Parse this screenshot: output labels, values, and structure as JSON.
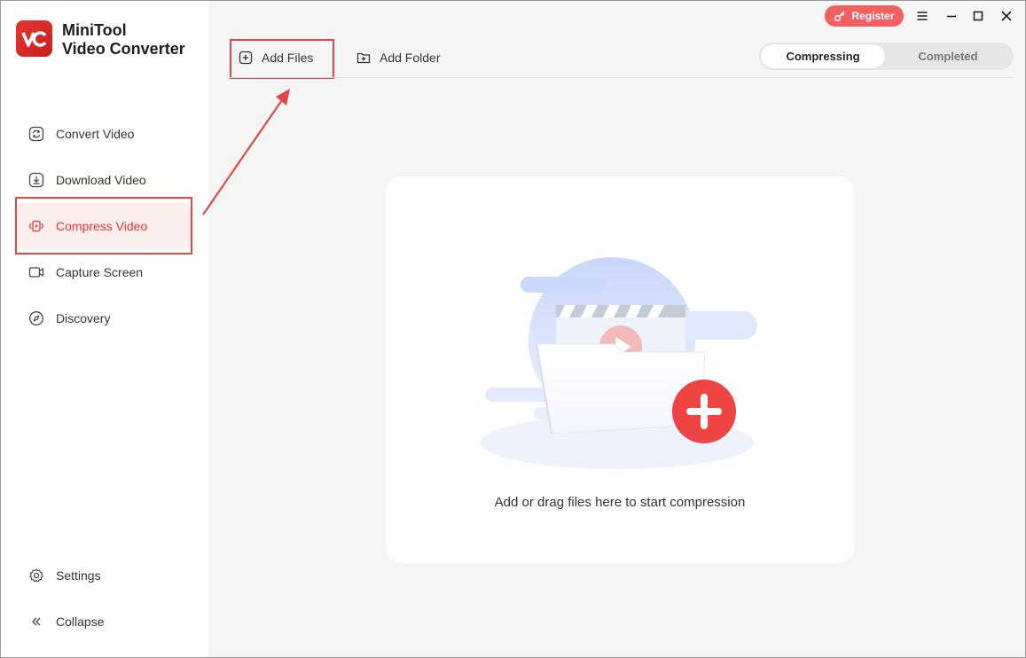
{
  "app": {
    "title_line1": "MiniTool",
    "title_line2": "Video Converter",
    "accent": "#e5362f"
  },
  "sidebar": {
    "items": [
      {
        "label": "Convert Video",
        "icon": "convert-icon",
        "active": false
      },
      {
        "label": "Download Video",
        "icon": "download-icon",
        "active": false
      },
      {
        "label": "Compress Video",
        "icon": "compress-icon",
        "active": true
      },
      {
        "label": "Capture Screen",
        "icon": "camera-icon",
        "active": false
      },
      {
        "label": "Discovery",
        "icon": "compass-icon",
        "active": false
      }
    ],
    "bottom": [
      {
        "label": "Settings",
        "icon": "gear-icon"
      },
      {
        "label": "Collapse",
        "icon": "chevron-double-left-icon"
      }
    ]
  },
  "titlebar": {
    "register_label": "Register"
  },
  "toolbar": {
    "add_files_label": "Add Files",
    "add_folder_label": "Add Folder"
  },
  "tabs": [
    {
      "label": "Compressing",
      "selected": true
    },
    {
      "label": "Completed",
      "selected": false
    }
  ],
  "dropzone": {
    "message": "Add or drag files here to start compression"
  }
}
